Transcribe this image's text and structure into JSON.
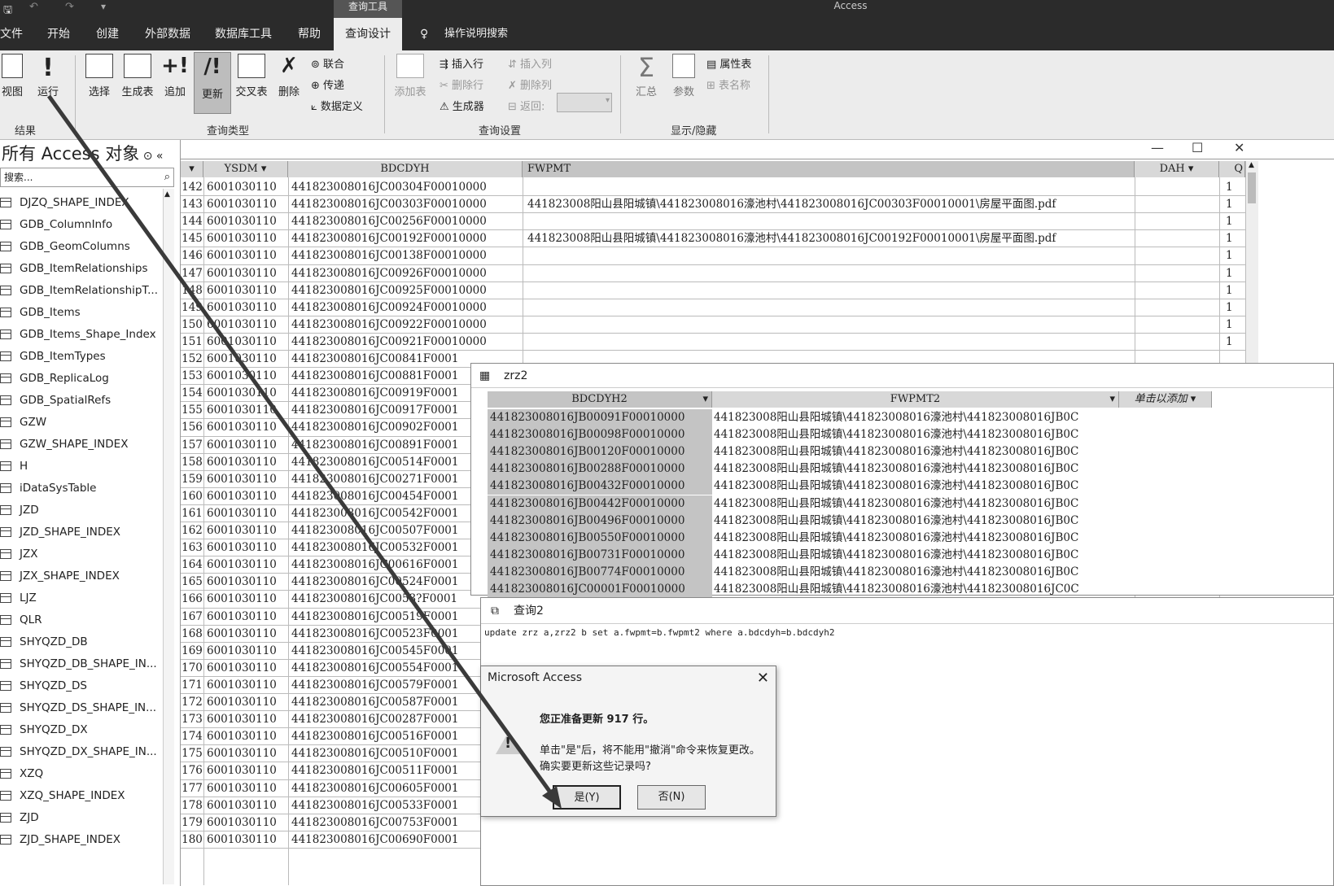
{
  "window": {
    "title": "Access",
    "context_tab": "查询工具"
  },
  "menu": [
    "文件",
    "开始",
    "创建",
    "外部数据",
    "数据库工具",
    "帮助",
    "查询设计"
  ],
  "tell_me": "操作说明搜索",
  "ribbon": {
    "results": {
      "group": "结果",
      "buttons": [
        "视图",
        "运行"
      ]
    },
    "query_type": {
      "group": "查询类型",
      "buttons": [
        "选择",
        "生成表",
        "追加",
        "更新",
        "交叉表",
        "删除"
      ],
      "small": [
        "联合",
        "传递",
        "数据定义"
      ]
    },
    "query_setup": {
      "group": "查询设置",
      "big": [
        "添加表"
      ],
      "small": [
        "插入行",
        "删除行",
        "生成器",
        "插入列",
        "删除列",
        "返回:"
      ]
    },
    "show_hide": {
      "group": "显示/隐藏",
      "buttons": [
        "汇总",
        "参数"
      ],
      "small": [
        "属性表",
        "表名称"
      ]
    }
  },
  "nav": {
    "title": "所有 Access 对象",
    "search_placeholder": "搜索...",
    "items": [
      "DJZQ_SHAPE_INDEX",
      "GDB_ColumnInfo",
      "GDB_GeomColumns",
      "GDB_ItemRelationships",
      "GDB_ItemRelationshipT...",
      "GDB_Items",
      "GDB_Items_Shape_Index",
      "GDB_ItemTypes",
      "GDB_ReplicaLog",
      "GDB_SpatialRefs",
      "GZW",
      "GZW_SHAPE_INDEX",
      "H",
      "iDataSysTable",
      "JZD",
      "JZD_SHAPE_INDEX",
      "JZX",
      "JZX_SHAPE_INDEX",
      "LJZ",
      "QLR",
      "SHYQZD_DB",
      "SHYQZD_DB_SHAPE_IN...",
      "SHYQZD_DS",
      "SHYQZD_DS_SHAPE_IN...",
      "SHYQZD_DX",
      "SHYQZD_DX_SHAPE_IN...",
      "XZQ",
      "XZQ_SHAPE_INDEX",
      "ZJD",
      "ZJD_SHAPE_INDEX"
    ]
  },
  "datasheet": {
    "columns": [
      "YSDM",
      "BDCDYH",
      "FWPMT",
      "DAH",
      "Q"
    ],
    "rows": [
      {
        "n": "142",
        "ysdm": "6001030110",
        "bdcdyh": "441823008016JC00304F00010000",
        "fwpmt": "",
        "q": "1"
      },
      {
        "n": "143",
        "ysdm": "6001030110",
        "bdcdyh": "441823008016JC00303F00010000",
        "fwpmt": "441823008阳山县阳城镇\\441823008016濠池村\\441823008016JC00303F00010001\\房屋平面图.pdf",
        "q": "1"
      },
      {
        "n": "144",
        "ysdm": "6001030110",
        "bdcdyh": "441823008016JC00256F00010000",
        "fwpmt": "",
        "q": "1"
      },
      {
        "n": "145",
        "ysdm": "6001030110",
        "bdcdyh": "441823008016JC00192F00010000",
        "fwpmt": "441823008阳山县阳城镇\\441823008016濠池村\\441823008016JC00192F00010001\\房屋平面图.pdf",
        "q": "1"
      },
      {
        "n": "146",
        "ysdm": "6001030110",
        "bdcdyh": "441823008016JC00138F00010000",
        "fwpmt": "",
        "q": "1"
      },
      {
        "n": "147",
        "ysdm": "6001030110",
        "bdcdyh": "441823008016JC00926F00010000",
        "fwpmt": "",
        "q": "1"
      },
      {
        "n": "148",
        "ysdm": "6001030110",
        "bdcdyh": "441823008016JC00925F00010000",
        "fwpmt": "",
        "q": "1"
      },
      {
        "n": "149",
        "ysdm": "6001030110",
        "bdcdyh": "441823008016JC00924F00010000",
        "fwpmt": "",
        "q": "1"
      },
      {
        "n": "150",
        "ysdm": "6001030110",
        "bdcdyh": "441823008016JC00922F00010000",
        "fwpmt": "",
        "q": "1"
      },
      {
        "n": "151",
        "ysdm": "6001030110",
        "bdcdyh": "441823008016JC00921F00010000",
        "fwpmt": "",
        "q": "1"
      },
      {
        "n": "152",
        "ysdm": "6001030110",
        "bdcdyh": "441823008016JC00841F0001",
        "fwpmt": "",
        "q": ""
      },
      {
        "n": "153",
        "ysdm": "6001030110",
        "bdcdyh": "441823008016JC00881F0001",
        "fwpmt": "",
        "q": ""
      },
      {
        "n": "154",
        "ysdm": "6001030110",
        "bdcdyh": "441823008016JC00919F0001",
        "fwpmt": "",
        "q": ""
      },
      {
        "n": "155",
        "ysdm": "6001030110",
        "bdcdyh": "441823008016JC00917F0001",
        "fwpmt": "",
        "q": ""
      },
      {
        "n": "156",
        "ysdm": "6001030110",
        "bdcdyh": "441823008016JC00902F0001",
        "fwpmt": "",
        "q": ""
      },
      {
        "n": "157",
        "ysdm": "6001030110",
        "bdcdyh": "441823008016JC00891F0001",
        "fwpmt": "",
        "q": ""
      },
      {
        "n": "158",
        "ysdm": "6001030110",
        "bdcdyh": "441823008016JC00514F0001",
        "fwpmt": "",
        "q": ""
      },
      {
        "n": "159",
        "ysdm": "6001030110",
        "bdcdyh": "441823008016JC00271F0001",
        "fwpmt": "",
        "q": ""
      },
      {
        "n": "160",
        "ysdm": "6001030110",
        "bdcdyh": "441823008016JC00454F0001",
        "fwpmt": "",
        "q": ""
      },
      {
        "n": "161",
        "ysdm": "6001030110",
        "bdcdyh": "441823008016JC00542F0001",
        "fwpmt": "",
        "q": ""
      },
      {
        "n": "162",
        "ysdm": "6001030110",
        "bdcdyh": "441823008016JC00507F0001",
        "fwpmt": "",
        "q": ""
      },
      {
        "n": "163",
        "ysdm": "6001030110",
        "bdcdyh": "441823008016JC00532F0001",
        "fwpmt": "",
        "q": ""
      },
      {
        "n": "164",
        "ysdm": "6001030110",
        "bdcdyh": "441823008016JC00616F0001",
        "fwpmt": "",
        "q": ""
      },
      {
        "n": "165",
        "ysdm": "6001030110",
        "bdcdyh": "441823008016JC00524F0001",
        "fwpmt": "",
        "q": ""
      },
      {
        "n": "166",
        "ysdm": "6001030110",
        "bdcdyh": "441823008016JC0053?F0001",
        "fwpmt": "",
        "q": ""
      },
      {
        "n": "167",
        "ysdm": "6001030110",
        "bdcdyh": "441823008016JC00519F0001",
        "fwpmt": "",
        "q": ""
      },
      {
        "n": "168",
        "ysdm": "6001030110",
        "bdcdyh": "441823008016JC00523F0001",
        "fwpmt": "",
        "q": ""
      },
      {
        "n": "169",
        "ysdm": "6001030110",
        "bdcdyh": "441823008016JC00545F0001",
        "fwpmt": "",
        "q": ""
      },
      {
        "n": "170",
        "ysdm": "6001030110",
        "bdcdyh": "441823008016JC00554F0001",
        "fwpmt": "",
        "q": ""
      },
      {
        "n": "171",
        "ysdm": "6001030110",
        "bdcdyh": "441823008016JC00579F0001",
        "fwpmt": "",
        "q": ""
      },
      {
        "n": "172",
        "ysdm": "6001030110",
        "bdcdyh": "441823008016JC00587F0001",
        "fwpmt": "",
        "q": ""
      },
      {
        "n": "173",
        "ysdm": "6001030110",
        "bdcdyh": "441823008016JC00287F0001",
        "fwpmt": "",
        "q": ""
      },
      {
        "n": "174",
        "ysdm": "6001030110",
        "bdcdyh": "441823008016JC00516F0001",
        "fwpmt": "",
        "q": ""
      },
      {
        "n": "175",
        "ysdm": "6001030110",
        "bdcdyh": "441823008016JC00510F0001",
        "fwpmt": "",
        "q": ""
      },
      {
        "n": "176",
        "ysdm": "6001030110",
        "bdcdyh": "441823008016JC00511F0001",
        "fwpmt": "",
        "q": ""
      },
      {
        "n": "177",
        "ysdm": "6001030110",
        "bdcdyh": "441823008016JC00605F0001",
        "fwpmt": "",
        "q": ""
      },
      {
        "n": "178",
        "ysdm": "6001030110",
        "bdcdyh": "441823008016JC00533F0001",
        "fwpmt": "",
        "q": ""
      },
      {
        "n": "179",
        "ysdm": "6001030110",
        "bdcdyh": "441823008016JC00753F0001",
        "fwpmt": "",
        "q": ""
      },
      {
        "n": "180",
        "ysdm": "6001030110",
        "bdcdyh": "441823008016JC00690F0001",
        "fwpmt": "",
        "q": ""
      }
    ]
  },
  "zrz2": {
    "title": "zrz2",
    "columns": [
      "BDCDYH2",
      "FWPMT2",
      "单击以添加"
    ],
    "rows": [
      {
        "bdcdyh2": "441823008016JB00091F00010000",
        "fwpmt2": "441823008阳山县阳城镇\\441823008016濠池村\\441823008016JB0C"
      },
      {
        "bdcdyh2": "441823008016JB00098F00010000",
        "fwpmt2": "441823008阳山县阳城镇\\441823008016濠池村\\441823008016JB0C"
      },
      {
        "bdcdyh2": "441823008016JB00120F00010000",
        "fwpmt2": "441823008阳山县阳城镇\\441823008016濠池村\\441823008016JB0C"
      },
      {
        "bdcdyh2": "441823008016JB00288F00010000",
        "fwpmt2": "441823008阳山县阳城镇\\441823008016濠池村\\441823008016JB0C"
      },
      {
        "bdcdyh2": "441823008016JB00432F00010000",
        "fwpmt2": "441823008阳山县阳城镇\\441823008016濠池村\\441823008016JB0C"
      },
      {
        "bdcdyh2": "441823008016JB00442F00010000",
        "fwpmt2": "441823008阳山县阳城镇\\441823008016濠池村\\441823008016JB0C"
      },
      {
        "bdcdyh2": "441823008016JB00496F00010000",
        "fwpmt2": "441823008阳山县阳城镇\\441823008016濠池村\\441823008016JB0C"
      },
      {
        "bdcdyh2": "441823008016JB00550F00010000",
        "fwpmt2": "441823008阳山县阳城镇\\441823008016濠池村\\441823008016JB0C"
      },
      {
        "bdcdyh2": "441823008016JB00731F00010000",
        "fwpmt2": "441823008阳山县阳城镇\\441823008016濠池村\\441823008016JB0C"
      },
      {
        "bdcdyh2": "441823008016JB00774F00010000",
        "fwpmt2": "441823008阳山县阳城镇\\441823008016濠池村\\441823008016JB0C"
      },
      {
        "bdcdyh2": "441823008016JC00001F00010000",
        "fwpmt2": "441823008阳山县阳城镇\\441823008016濠池村\\441823008016JC0C"
      }
    ]
  },
  "query2": {
    "title": "查询2",
    "sql": "update zrz a,zrz2 b set a.fwpmt=b.fwpmt2 where a.bdcdyh=b.bdcdyh2"
  },
  "dialog": {
    "title": "Microsoft Access",
    "line1": "您正准备更新 917 行。",
    "line2": "单击\"是\"后，将不能用\"撤消\"命令来恢复更改。",
    "line3": "确实要更新这些记录吗?",
    "yes": "是(Y)",
    "no": "否(N)"
  },
  "colors": {
    "titlebar": "#2b2b2b",
    "ribbon": "#ececec",
    "header": "#d8d8d8",
    "selected_col": "#c4c4c4"
  }
}
